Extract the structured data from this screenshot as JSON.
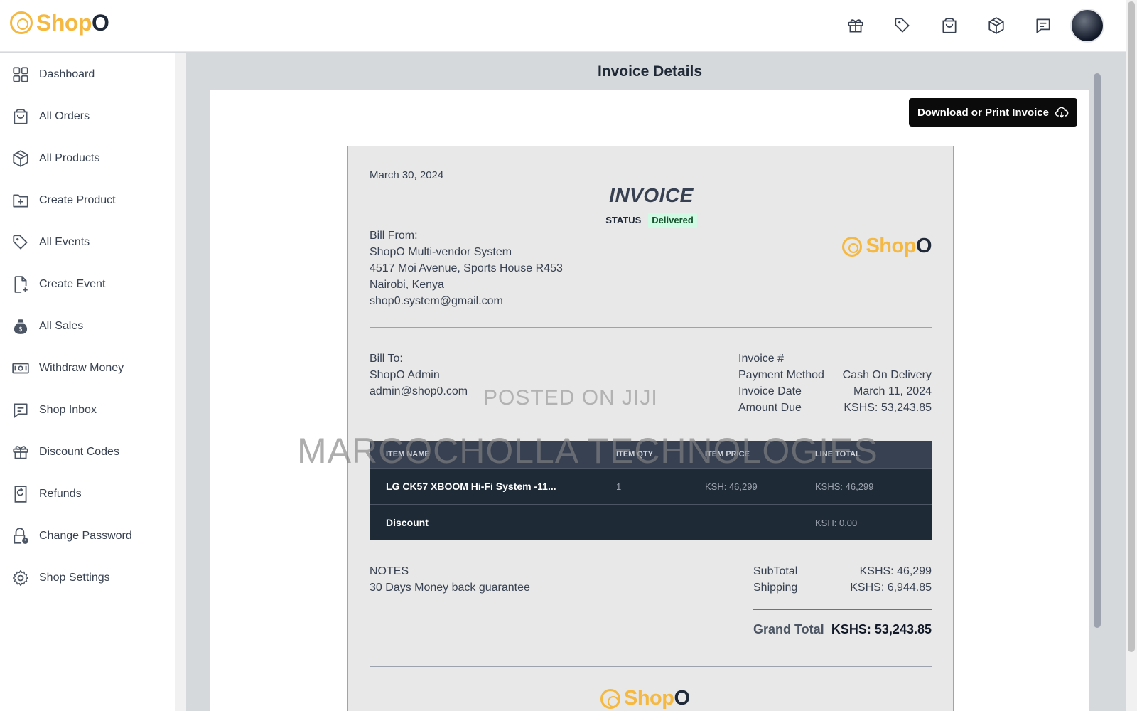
{
  "brand": {
    "logo_main": "Shop",
    "logo_o": "O"
  },
  "topbar": {
    "icons": [
      "gift-icon",
      "tag-icon",
      "shopping-bag-icon",
      "package-icon",
      "message-icon"
    ]
  },
  "sidebar": {
    "items": [
      {
        "label": "Dashboard",
        "icon": "dashboard-icon"
      },
      {
        "label": "All Orders",
        "icon": "shopping-bag-icon"
      },
      {
        "label": "All Products",
        "icon": "package-icon"
      },
      {
        "label": "Create Product",
        "icon": "folder-plus-icon"
      },
      {
        "label": "All Events",
        "icon": "tag-icon"
      },
      {
        "label": "Create Event",
        "icon": "file-plus-icon"
      },
      {
        "label": "All Sales",
        "icon": "money-bag-icon"
      },
      {
        "label": "Withdraw Money",
        "icon": "cash-icon"
      },
      {
        "label": "Shop Inbox",
        "icon": "message-icon"
      },
      {
        "label": "Discount Codes",
        "icon": "gift-icon"
      },
      {
        "label": "Refunds",
        "icon": "refund-icon"
      },
      {
        "label": "Change Password",
        "icon": "lock-icon"
      },
      {
        "label": "Shop Settings",
        "icon": "gear-icon"
      }
    ]
  },
  "main": {
    "title": "Invoice Details",
    "download_label": "Download or Print Invoice"
  },
  "invoice": {
    "date": "March 30, 2024",
    "title": "INVOICE",
    "status_label": "STATUS",
    "status_value": "Delivered",
    "bill_from": {
      "heading": "Bill From:",
      "name": "ShopO Multi-vendor System",
      "address": "4517 Moi Avenue, Sports House R453",
      "city": "Nairobi, Kenya",
      "email": "shop0.system@gmail.com"
    },
    "bill_to": {
      "heading": "Bill To:",
      "name": "ShopO Admin",
      "email": "admin@shop0.com"
    },
    "meta": {
      "invoice_no_label": "Invoice #",
      "invoice_no_value": "",
      "payment_method_label": "Payment Method",
      "payment_method_value": "Cash On Delivery",
      "invoice_date_label": "Invoice Date",
      "invoice_date_value": "March 11, 2024",
      "amount_due_label": "Amount Due",
      "amount_due_value": "KSHS: 53,243.85"
    },
    "table": {
      "headers": [
        "ITEM NAME",
        "ITEM QTY",
        "ITEM PRICE",
        "LINE TOTAL"
      ],
      "rows": [
        [
          "LG CK57 XBOOM Hi-Fi System -11...",
          "1",
          "KSH: 46,299",
          "KSHS: 46,299"
        ],
        [
          "Discount",
          "",
          "",
          "KSH: 0.00"
        ]
      ]
    },
    "notes": {
      "heading": "NOTES",
      "text": "30 Days Money back guarantee"
    },
    "totals": {
      "subtotal_label": "SubTotal",
      "subtotal_value": "KSHS: 46,299",
      "shipping_label": "Shipping",
      "shipping_value": "KSHS: 6,944.85",
      "grand_label": "Grand Total",
      "grand_value": "KSHS: 53,243.85"
    }
  },
  "watermarks": {
    "line1": "POSTED ON JIJI",
    "line2": "MARCOCHOLLA TECHNOLOGIES"
  },
  "colors": {
    "brand_yellow": "#f5b841",
    "table_dark": "#1f2a37",
    "status_green_bg": "#d1fae5"
  }
}
